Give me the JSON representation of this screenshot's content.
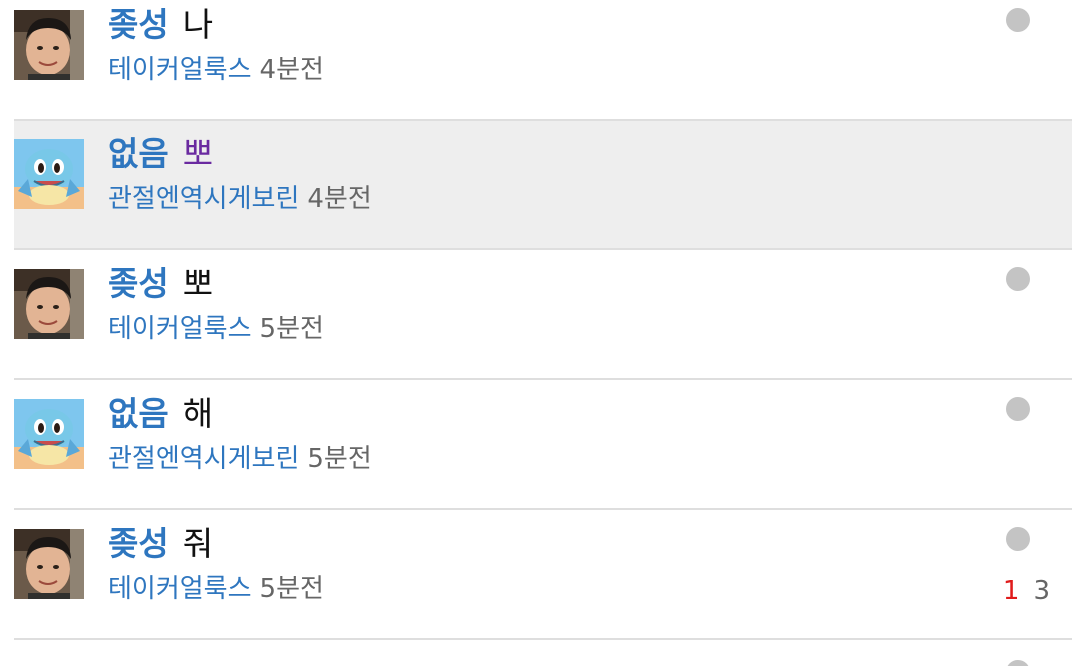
{
  "posts": [
    {
      "author": "좆성",
      "title": "나",
      "board": "테이커얼룩스",
      "time": "4분전",
      "avatar": "boy-photo-avatar",
      "selected": false,
      "unread_dot": true
    },
    {
      "author": "없음",
      "title": "뽀",
      "board": "관절엔역시게보린",
      "time": "4분전",
      "avatar": "squirtle-avatar",
      "selected": true,
      "visited": true,
      "unread_dot": false
    },
    {
      "author": "좆성",
      "title": "뽀",
      "board": "테이커얼룩스",
      "time": "5분전",
      "avatar": "boy-photo-avatar",
      "selected": false,
      "unread_dot": true
    },
    {
      "author": "없음",
      "title": "해",
      "board": "관절엔역시게보린",
      "time": "5분전",
      "avatar": "squirtle-avatar",
      "selected": false,
      "unread_dot": true
    },
    {
      "author": "좆성",
      "title": "줘",
      "board": "테이커얼룩스",
      "time": "5분전",
      "avatar": "boy-photo-avatar",
      "selected": false,
      "unread_dot": true,
      "stat_red": "1",
      "stat_gray": "3"
    }
  ],
  "colors": {
    "author": "#2e76bf",
    "board": "#2e76bf",
    "time": "#666666",
    "visited_title": "#6a2aa0",
    "selected_row": "#eeeeee",
    "divider": "#dedede",
    "dot": "#c4c4c4",
    "stat_red": "#e01b1b"
  }
}
